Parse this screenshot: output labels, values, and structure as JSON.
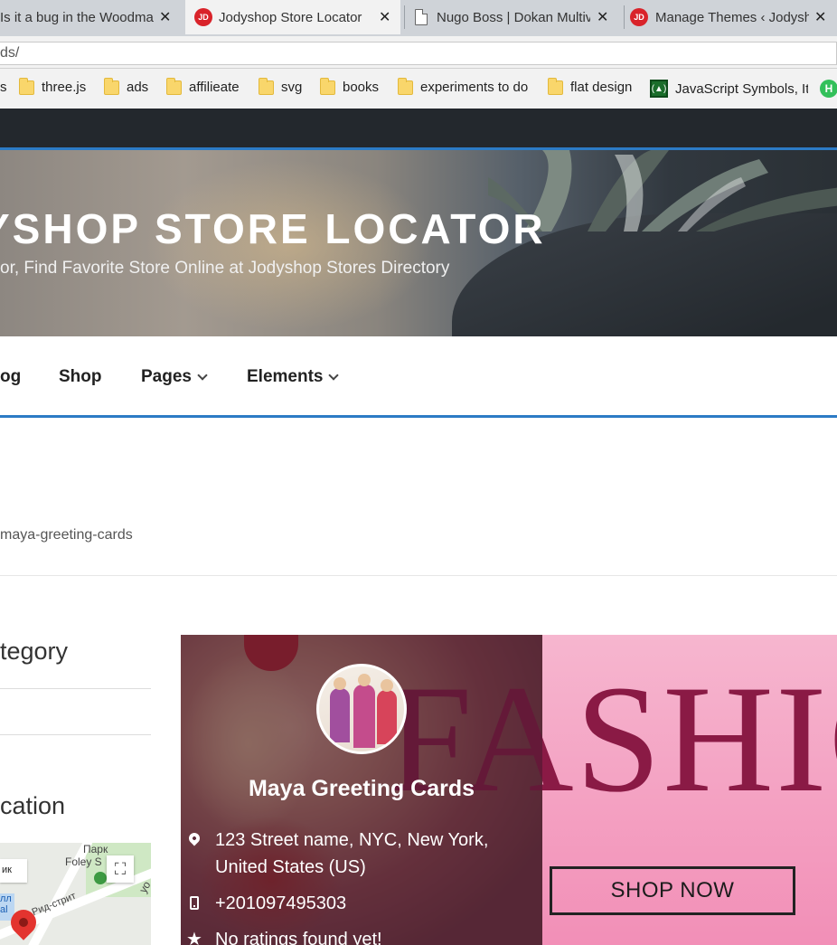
{
  "browser": {
    "tabs": [
      {
        "title": "Is it a bug in the Woodma",
        "favicon": "none",
        "close": "✕"
      },
      {
        "title": "Jodyshop Store Locator",
        "favicon": "jd-icon",
        "close": "✕",
        "active": true
      },
      {
        "title": "Nugo Boss | Dokan Multiv",
        "favicon": "document-icon",
        "close": "✕"
      },
      {
        "title": "Manage Themes ‹ Jodysh",
        "favicon": "jd-icon",
        "close": "✕"
      }
    ],
    "favicon_text": "JD",
    "url": "ds/",
    "bookmarks": [
      {
        "label": "s",
        "icon": "none"
      },
      {
        "label": "three.js",
        "icon": "folder-icon"
      },
      {
        "label": "ads",
        "icon": "folder-icon"
      },
      {
        "label": "affilieate",
        "icon": "folder-icon"
      },
      {
        "label": "svg",
        "icon": "folder-icon"
      },
      {
        "label": "books",
        "icon": "folder-icon"
      },
      {
        "label": "experiments to do",
        "icon": "folder-icon"
      },
      {
        "label": "flat design",
        "icon": "folder-icon"
      },
      {
        "label": "JavaScript Symbols, It",
        "icon": "js-icon"
      },
      {
        "label": "",
        "icon": "h-icon"
      }
    ],
    "bookmark_js_glyph": "(▲)",
    "bookmark_h_glyph": "H"
  },
  "header": {
    "site_title": "YSHOP STORE LOCATOR",
    "site_description": "or, Find Favorite Store Online at Jodyshop Stores Directory"
  },
  "nav": {
    "items": [
      {
        "label": "og",
        "has_dropdown": false
      },
      {
        "label": "Shop",
        "has_dropdown": false
      },
      {
        "label": "Pages",
        "has_dropdown": true
      },
      {
        "label": "Elements",
        "has_dropdown": true
      }
    ]
  },
  "breadcrumb": "maya-greeting-cards",
  "sidebar": {
    "category_title": "tegory",
    "location_title": "cation",
    "map": {
      "park_label": "Парк",
      "park_label2": "Foley S",
      "street_label": "Рид-стрит",
      "box_label": "ик",
      "side_label": "лл",
      "side_label2": "al",
      "edge_label": "уо",
      "fullscreen_glyph": "⛶"
    }
  },
  "store": {
    "name": "Maya Greeting Cards",
    "address": "123 Street name, NYC, New York, United States (US)",
    "phone": "+201097495303",
    "rating_text": "No ratings found yet!",
    "rating_glyph": "★",
    "banner_word": "FASHIO",
    "cta": "SHOP NOW"
  },
  "colors": {
    "accent": "#2c7bc5",
    "adminbar": "#23282d",
    "banner_pink": "#f28fb7",
    "fashion_text": "#8a1a45"
  }
}
